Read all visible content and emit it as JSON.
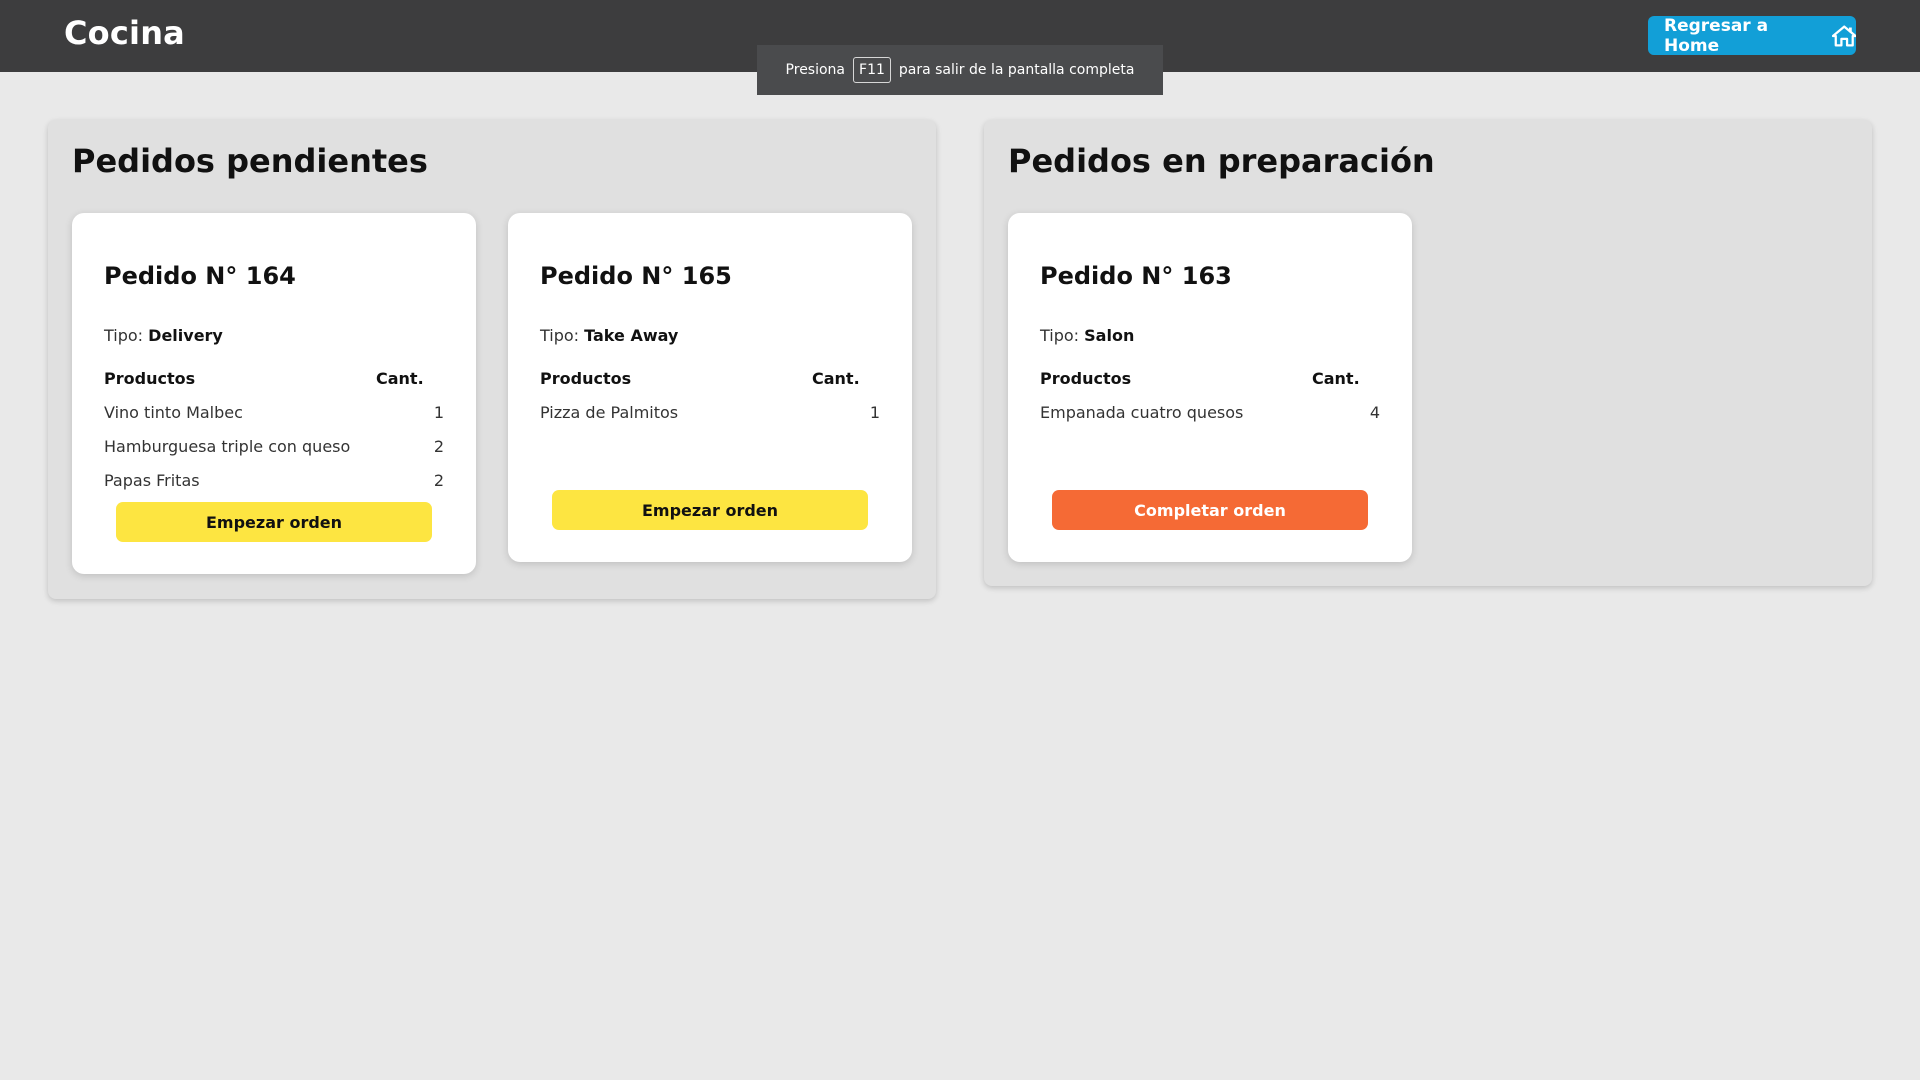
{
  "header": {
    "title": "Cocina",
    "home_button_label": "Regresar a Home",
    "home_icon": "home-icon"
  },
  "fullscreen_notice": {
    "prefix": "Presiona",
    "key": "F11",
    "suffix": "para salir de la pantalla completa"
  },
  "pending": {
    "title": "Pedidos pendientes",
    "orders": [
      {
        "title": "Pedido N° 164",
        "type_label": "Tipo:",
        "type_value": "Delivery",
        "products_header": "Productos",
        "qty_header": "Cant.",
        "items": [
          {
            "name": "Vino tinto Malbec",
            "qty": "1"
          },
          {
            "name": "Hamburguesa triple con queso",
            "qty": "2"
          },
          {
            "name": "Papas Fritas",
            "qty": "2"
          }
        ],
        "action_label": "Empezar orden"
      },
      {
        "title": "Pedido N° 165",
        "type_label": "Tipo:",
        "type_value": "Take Away",
        "products_header": "Productos",
        "qty_header": "Cant.",
        "items": [
          {
            "name": "Pizza de Palmitos",
            "qty": "1"
          }
        ],
        "action_label": "Empezar orden"
      }
    ]
  },
  "in_progress": {
    "title": "Pedidos en preparación",
    "orders": [
      {
        "title": "Pedido N° 163",
        "type_label": "Tipo:",
        "type_value": "Salon",
        "products_header": "Productos",
        "qty_header": "Cant.",
        "items": [
          {
            "name": "Empanada cuatro quesos",
            "qty": "4"
          }
        ],
        "action_label": "Completar orden"
      }
    ]
  },
  "colors": {
    "topbar": "#3d3d3e",
    "home_button": "#129fd7",
    "start_button": "#fde541",
    "complete_button": "#f56a35"
  }
}
